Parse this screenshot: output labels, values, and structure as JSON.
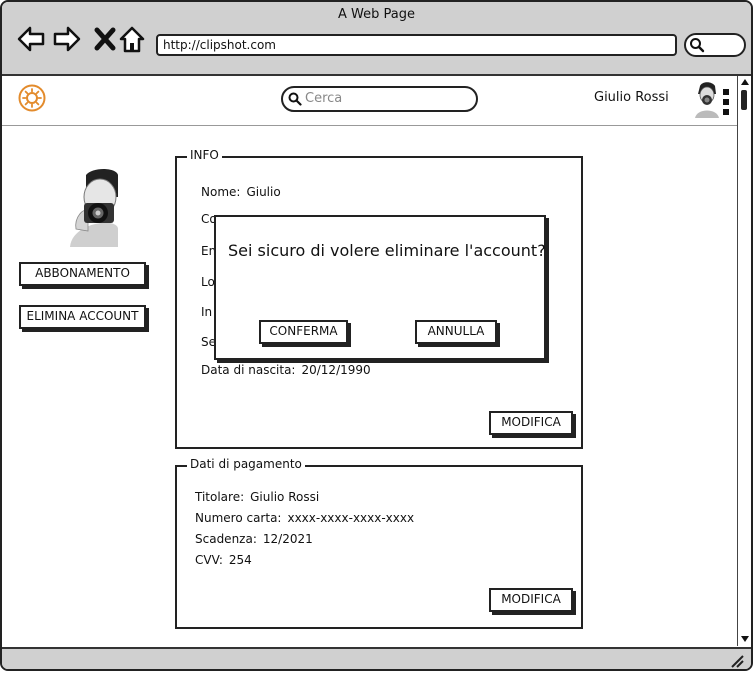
{
  "browser": {
    "title": "A Web Page",
    "url": "http://clipshot.com"
  },
  "header": {
    "search_placeholder": "Cerca",
    "user_name": "Giulio Rossi",
    "logo_icon": "sun-logo-icon",
    "accent_color": "#e38b2c"
  },
  "sidebar": {
    "subscription_button": "ABBONAMENTO",
    "delete_account_button": "ELIMINA ACCOUNT"
  },
  "info": {
    "legend": "INFO",
    "rows": [
      {
        "label": "Nome:",
        "value": "Giulio"
      },
      {
        "label": "Co",
        "value": ""
      },
      {
        "label": "Em",
        "value": ""
      },
      {
        "label": "Lo",
        "value": ""
      },
      {
        "label": "In",
        "value": ""
      },
      {
        "label": "Se",
        "value": ""
      },
      {
        "label": "Data di nascita:",
        "value": "20/12/1990"
      }
    ],
    "edit_button": "MODIFICA"
  },
  "payment": {
    "legend": "Dati di pagamento",
    "rows": [
      {
        "label": "Titolare:",
        "value": "Giulio Rossi"
      },
      {
        "label": "Numero carta:",
        "value": "xxxx-xxxx-xxxx-xxxx"
      },
      {
        "label": "Scadenza:",
        "value": "12/2021"
      },
      {
        "label": "CVV:",
        "value": "254"
      }
    ],
    "edit_button": "MODIFICA"
  },
  "modal": {
    "message": "Sei sicuro di volere eliminare l'account?",
    "confirm_button": "CONFERMA",
    "cancel_button": "ANNULLA"
  }
}
